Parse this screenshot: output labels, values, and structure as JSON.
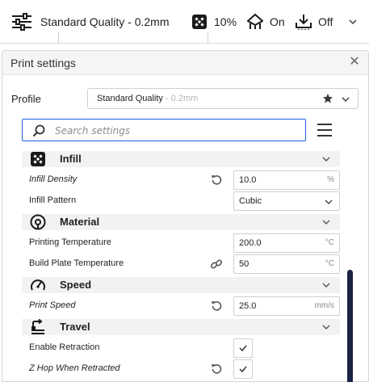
{
  "topbar": {
    "profile_label": "Standard Quality - 0.2mm",
    "infill_label": "10%",
    "support_label": "On",
    "adhesion_label": "Off"
  },
  "panel": {
    "title": "Print settings",
    "profile_label": "Profile",
    "profile_name": "Standard Quality",
    "profile_suffix": " - 0.2mm"
  },
  "search": {
    "placeholder": "Search settings"
  },
  "categories": {
    "infill": "Infill",
    "material": "Material",
    "speed": "Speed",
    "travel": "Travel"
  },
  "settings": {
    "infill_density": {
      "label": "Infill Density",
      "value": "10.0",
      "unit": "%"
    },
    "infill_pattern": {
      "label": "Infill Pattern",
      "value": "Cubic"
    },
    "printing_temperature": {
      "label": "Printing Temperature",
      "value": "200.0",
      "unit": "°C"
    },
    "build_plate_temperature": {
      "label": "Build Plate Temperature",
      "value": "50",
      "unit": "°C"
    },
    "print_speed": {
      "label": "Print Speed",
      "value": "25.0",
      "unit": "mm/s"
    },
    "enable_retraction": {
      "label": "Enable Retraction",
      "checked": true
    },
    "z_hop_when_retracted": {
      "label": "Z Hop When Retracted",
      "checked": true
    }
  },
  "colors": {
    "accent": "#1e62d6",
    "scrollbar": "#1b2445",
    "category_bg": "#f2f2f2"
  }
}
